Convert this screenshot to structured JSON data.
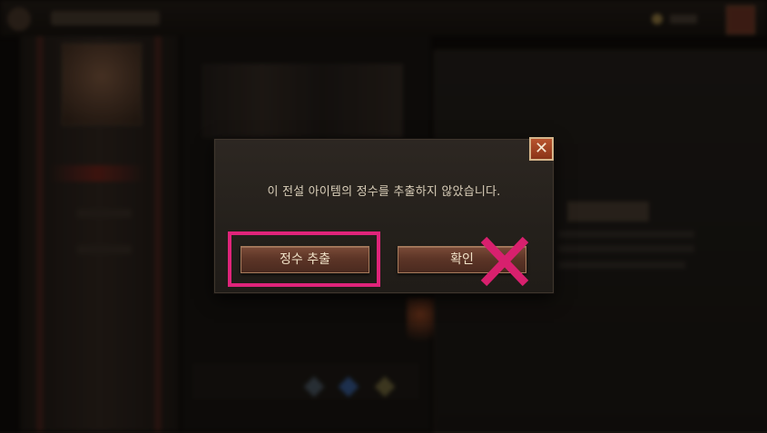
{
  "dialog": {
    "message": "이 전설 아이템의 정수를 추출하지 않았습니다.",
    "close_label": "✕",
    "buttons": {
      "extract_label": "정수 추출",
      "confirm_label": "확인"
    }
  },
  "annotations": {
    "highlight_color": "#e0247a",
    "cross_color": "#d8206e"
  }
}
